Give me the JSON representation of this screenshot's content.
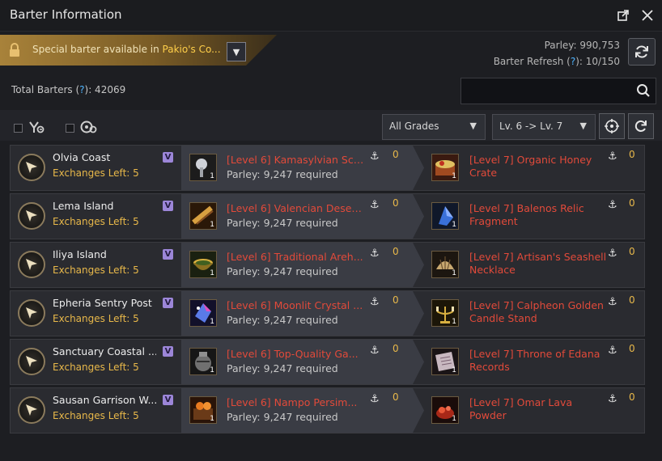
{
  "window": {
    "title": "Barter Information"
  },
  "special": {
    "prefix": "Special barter available in ",
    "place": "Pakio's Co..."
  },
  "parley": {
    "label": "Parley: 990,753",
    "refresh_prefix": "Barter Refresh (",
    "refresh_q": "?",
    "refresh_suffix": "): 10/150"
  },
  "total": {
    "prefix": "Total Barters (",
    "q": "?",
    "suffix": "): 42069"
  },
  "search": {
    "value": ""
  },
  "filters": {
    "grade": "All Grades",
    "level": "Lv. 6 -> Lv. 7"
  },
  "barters": [
    {
      "location": "Olvia Coast",
      "exchanges": "Exchanges Left: 5",
      "v": "V",
      "give": "[Level 6] Kamasylvian Scu...",
      "parley": "Parley: 9,247 required",
      "give_count": "0",
      "give_qty": "1",
      "get": "[Level 7] Organic Honey Crate",
      "get_count": "0",
      "get_qty": "1",
      "give_icon": "silver-tree-icon",
      "get_icon": "honey-crate-icon"
    },
    {
      "location": "Lema Island",
      "exchanges": "Exchanges Left: 5",
      "v": "V",
      "give": "[Level 6] Valencian Desert...",
      "parley": "Parley: 9,247 required",
      "give_count": "0",
      "give_qty": "1",
      "get": "[Level 7] Balenos Relic Fragment",
      "get_count": "0",
      "get_qty": "1",
      "give_icon": "desert-scroll-icon",
      "get_icon": "relic-fragment-icon"
    },
    {
      "location": "Iliya Island",
      "exchanges": "Exchanges Left: 5",
      "v": "V",
      "give": "[Level 6] Traditional Areh...",
      "parley": "Parley: 9,247 required",
      "give_count": "0",
      "give_qty": "1",
      "get": "[Level 7] Artisan's Seashell Necklace",
      "get_count": "0",
      "get_qty": "1",
      "give_icon": "bowl-icon",
      "get_icon": "seashell-icon"
    },
    {
      "location": "Epheria Sentry Post",
      "exchanges": "Exchanges Left: 5",
      "v": "V",
      "give": "[Level 6] Moonlit Crystal ...",
      "parley": "Parley: 9,247 required",
      "give_count": "0",
      "give_qty": "1",
      "get": "[Level 7] Calpheon Golden Candle Stand",
      "get_count": "0",
      "get_qty": "1",
      "give_icon": "crystal-icon",
      "get_icon": "candle-stand-icon"
    },
    {
      "location": "Sanctuary Coastal ...",
      "exchanges": "Exchanges Left: 5",
      "v": "V",
      "give": "[Level 6] Top-Quality Ga...",
      "parley": "Parley: 9,247 required",
      "give_count": "0",
      "give_qty": "1",
      "get": "[Level 7] Throne of Edana Records",
      "get_count": "0",
      "get_qty": "1",
      "give_icon": "jar-icon",
      "get_icon": "records-book-icon"
    },
    {
      "location": "Sausan Garrison W...",
      "exchanges": "Exchanges Left: 5",
      "v": "V",
      "give": "[Level 6] Nampo Persim...",
      "parley": "Parley: 9,247 required",
      "give_count": "0",
      "give_qty": "1",
      "get": "[Level 7] Omar Lava Powder",
      "get_count": "0",
      "get_qty": "1",
      "give_icon": "persimmon-chest-icon",
      "get_icon": "lava-powder-icon"
    }
  ],
  "colors": {
    "accent_gold": "#e8b84a",
    "item_red": "#e24a3a",
    "help_blue": "#4fb5ff"
  }
}
